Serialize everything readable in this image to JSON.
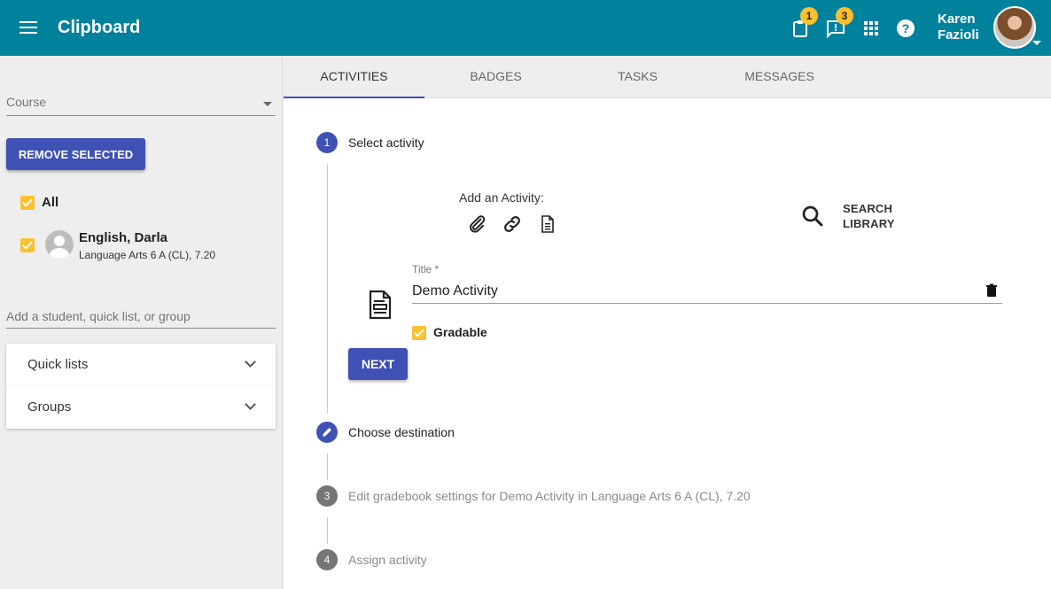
{
  "app": {
    "title": "Clipboard"
  },
  "header": {
    "clipboard_badge": "1",
    "messages_badge": "3",
    "user_first": "Karen",
    "user_last": "Fazioli",
    "icons": [
      "menu-icon",
      "clipboard-icon",
      "feedback-icon",
      "apps-grid-icon",
      "help-icon"
    ]
  },
  "sidebar": {
    "course_placeholder": "Course",
    "remove_selected": "REMOVE SELECTED",
    "all_label": "All",
    "student": {
      "name": "English, Darla",
      "course": "Language Arts 6 A (CL), 7.20"
    },
    "add_placeholder": "Add a student, quick list, or group",
    "panels": [
      {
        "label": "Quick lists"
      },
      {
        "label": "Groups"
      }
    ]
  },
  "tabs": [
    {
      "label": "ACTIVITIES",
      "active": true
    },
    {
      "label": "BADGES"
    },
    {
      "label": "TASKS"
    },
    {
      "label": "MESSAGES"
    }
  ],
  "steps": [
    {
      "number": "1",
      "label": "Select activity",
      "state": "active"
    },
    {
      "number": "",
      "label": "Choose destination",
      "state": "edit"
    },
    {
      "number": "3",
      "label": "Edit gradebook settings for Demo Activity in Language Arts 6 A (CL), 7.20",
      "state": "pending"
    },
    {
      "number": "4",
      "label": "Assign activity",
      "state": "pending"
    }
  ],
  "activity": {
    "add_label": "Add an Activity:",
    "add_icons": [
      "attachment-icon",
      "link-icon",
      "document-icon"
    ],
    "search_library_line1": "SEARCH",
    "search_library_line2": "LIBRARY",
    "title_label": "Title *",
    "title_value": "Demo Activity",
    "gradable_label": "Gradable",
    "next_label": "NEXT"
  },
  "colors": {
    "appbar": "#00819c",
    "primary": "#3f51b5",
    "accent": "#fbc02d"
  }
}
